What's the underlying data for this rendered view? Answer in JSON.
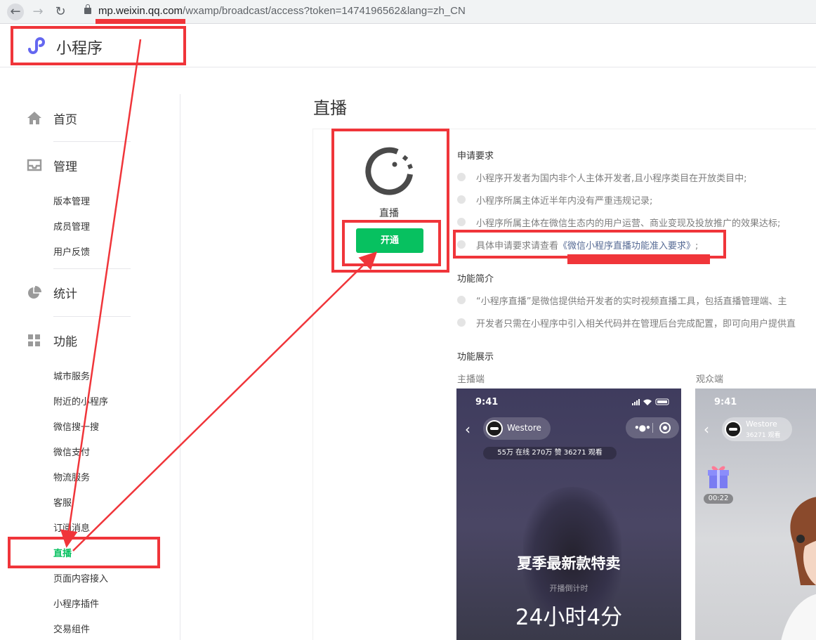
{
  "browser": {
    "url_host": "mp.weixin.qq.com",
    "url_path": "/wxamp/broadcast/access?token=1474196562&lang=zh_CN"
  },
  "app": {
    "name": "小程序"
  },
  "sidebar": {
    "groups": [
      {
        "label": "首页",
        "icon": "home-icon"
      },
      {
        "label": "管理",
        "icon": "inbox-icon"
      },
      {
        "label": "统计",
        "icon": "pie-chart-icon"
      },
      {
        "label": "功能",
        "icon": "grid-icon"
      }
    ],
    "manage_items": [
      "版本管理",
      "成员管理",
      "用户反馈"
    ],
    "feature_items": [
      "城市服务",
      "附近的小程序",
      "微信搜一搜",
      "微信支付",
      "物流服务",
      "客服",
      "订阅消息",
      "直播",
      "页面内容接入",
      "小程序插件",
      "交易组件"
    ],
    "active_item": "直播"
  },
  "main": {
    "title": "直播",
    "plugin": {
      "name": "直播",
      "open_label": "开通"
    },
    "requirements": {
      "title": "申请要求",
      "items": [
        "小程序开发者为国内非个人主体开发者,且小程序类目在开放类目中;",
        "小程序所属主体近半年内没有严重违规记录;",
        "小程序所属主体在微信生态内的用户运营、商业变现及投放推广的效果达标;"
      ],
      "detail_prefix": "具体申请要求请查看",
      "detail_link": "《微信小程序直播功能准入要求》",
      "detail_suffix": ";"
    },
    "intro": {
      "title": "功能简介",
      "items": [
        "“小程序直播”是微信提供给开发者的实时视频直播工具，包括直播管理端、主",
        "开发者只需在小程序中引入相关代码并在管理后台完成配置，即可向用户提供直"
      ]
    },
    "demo": {
      "title": "功能展示",
      "anchor_label": "主播端",
      "viewer_label": "观众端",
      "anchor_phone": {
        "time": "9:41",
        "name": "Westore",
        "stats": "55万 在线  270万 赞  36271 观看",
        "promo": "夏季最新款特卖",
        "countdown_label": "开播倒计时",
        "countdown": "24小时4分"
      },
      "viewer_phone": {
        "time": "9:41",
        "name": "Westore",
        "stat": "36271 观看",
        "gift_timer": "00:22"
      }
    }
  },
  "colors": {
    "accent": "#07c160",
    "annotation": "#f0353a",
    "link": "#576b95"
  }
}
